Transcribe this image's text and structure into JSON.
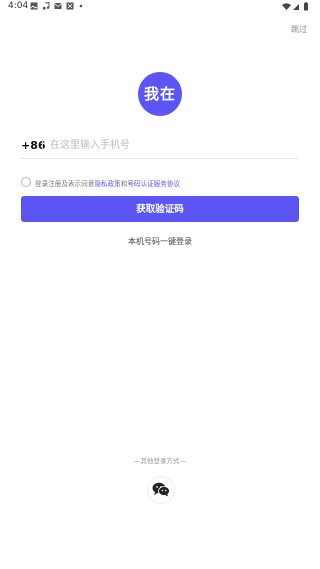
{
  "status_bar": {
    "time": "4:04",
    "left_icons": [
      "image-icon",
      "music-icon",
      "mail-icon",
      "app-icon",
      "dot-icon"
    ],
    "right_icons": [
      "wifi-icon",
      "signal-icon",
      "battery-icon"
    ]
  },
  "header": {
    "skip_label": "跳过"
  },
  "logo": {
    "text": "我在",
    "color": "#5b56f3"
  },
  "phone": {
    "country_code": "+86",
    "placeholder": "在这里输入手机号",
    "value": ""
  },
  "agreement": {
    "prefix": "登录注册及表示同意",
    "privacy_link": "隐私政策",
    "conjunction": "和",
    "service_link": "号码认证服务协议",
    "checked": false
  },
  "actions": {
    "get_code_label": "获取验证码",
    "one_key_label": "本机号码一键登录"
  },
  "other_login": {
    "label": "—其他登录方式—",
    "methods": [
      "wechat-icon"
    ]
  },
  "colors": {
    "accent": "#5b56f3"
  }
}
